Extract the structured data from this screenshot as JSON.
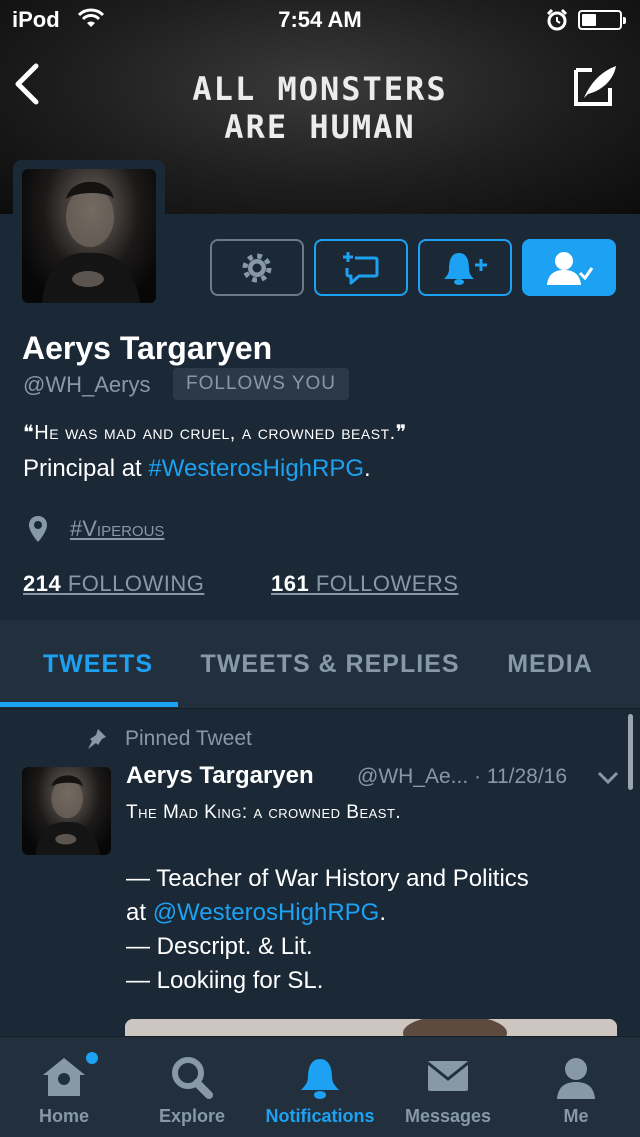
{
  "status_bar": {
    "carrier": "iPod",
    "time": "7:54 AM"
  },
  "banner": {
    "line1": "ALL MONSTERS",
    "line2": "ARE HUMAN"
  },
  "profile": {
    "name": "Aerys Targaryen",
    "handle": "@WH_Aerys",
    "follows_you": "FOLLOWS YOU",
    "bio_quote": "❝He was mad and cruel, a crowned beast.❞",
    "bio_prefix": "Principal at ",
    "bio_link": "#WesterosHighRPG",
    "bio_suffix": ".",
    "location": "#Viperous",
    "following_count": "214",
    "following_label": " FOLLOWING",
    "followers_count": "161",
    "followers_label": " FOLLOWERS"
  },
  "tabs": [
    "TWEETS",
    "TWEETS & REPLIES",
    "MEDIA"
  ],
  "pinned_tweet": {
    "pinned_label": "Pinned Tweet",
    "author": "Aerys Targaryen",
    "meta": "@WH_Ae... · 11/28/16",
    "line1": "The Mad King: a crowned Beast.",
    "body_1": "— Teacher of War History and Politics",
    "body_2_prefix": "at ",
    "body_2_link": "@WesterosHighRPG",
    "body_2_suffix": ".",
    "body_3": "— Descript. & Lit.",
    "body_4": "— Lookiing for SL."
  },
  "tab_bar": [
    "Home",
    "Explore",
    "Notifications",
    "Messages",
    "Me"
  ],
  "colors": {
    "accent": "#1da1f2",
    "background": "#1b2836",
    "muted": "#8899a6"
  }
}
